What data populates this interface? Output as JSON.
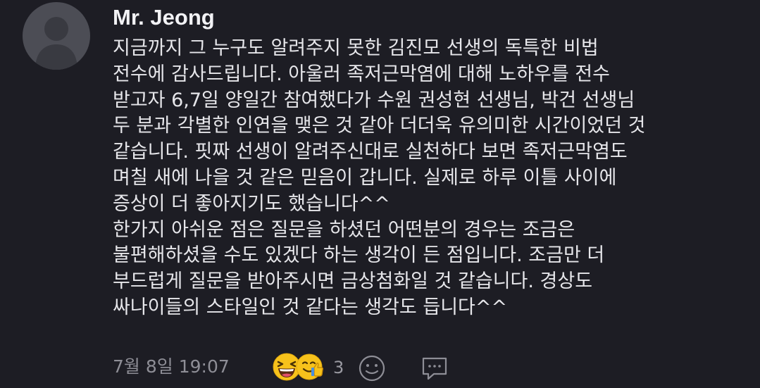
{
  "comment": {
    "author": "Mr. Jeong",
    "lines": [
      "지금까지 그 누구도 알려주지 못한 김진모 선생의 독특한 비법",
      "전수에 감사드립니다. 아울러 족저근막염에 대해 노하우를 전수",
      "받고자 6,7일 양일간 참여했다가 수원 권성현 선생님, 박건 선생님",
      "두 분과 각별한 인연을 맺은 것 같아 더더욱 유의미한 시간이었던 것",
      "같습니다. 핏짜 선생이 알려주신대로 실천하다 보면 족저근막염도",
      "며칠 새에 나을 것 같은 믿음이 갑니다. 실제로 하루 이틀 사이에",
      "증상이 더 좋아지기도 했습니다^^",
      "한가지 아쉬운 점은 질문을 하셨던 어떤분의 경우는 조금은",
      "불편해하셨을 수도 있겠다 하는 생각이 든 점입니다. 조금만 더",
      "부드럽게 질문을 받아주시면 금상첨화일 것 같습니다. 경상도",
      "싸나이들의 스타일인 것 같다는 생각도 듭니다^^"
    ],
    "timestamp": "7월 8일 19:07",
    "reactions": {
      "emojis": [
        "laughing-face-icon",
        "thumbs-up-face-icon"
      ],
      "count": "3"
    },
    "icons": {
      "add_reaction": "smiley-icon",
      "reply": "speech-bubble-icon"
    }
  },
  "colors": {
    "background": "#1d1d24",
    "text": "#e6e6ea",
    "muted": "#8e8e96",
    "avatar": "#4c4d55",
    "emoji_yellow": "#f7c21b"
  }
}
